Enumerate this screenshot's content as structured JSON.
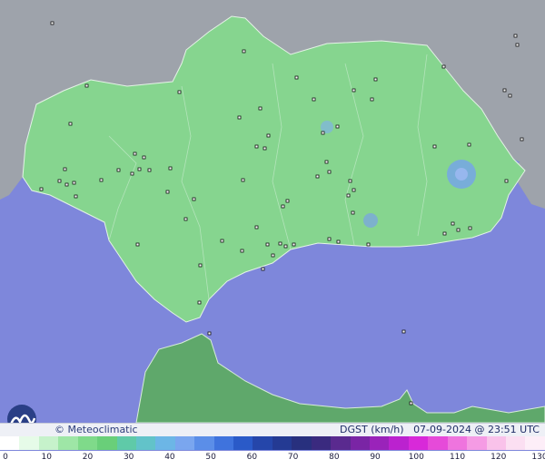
{
  "map": {
    "brand": "© Meteoclimatic",
    "parameter": "DGST (km/h)",
    "datetime": "07-09-2024 @ 23:51 UTC",
    "colors": {
      "sea": "#7e87db",
      "land_outside": "#9aa0aa",
      "region_land": "#86d58f",
      "region_land_dark": "#6fbf7c",
      "north_africa": "#5fa86b"
    },
    "logo_icon": "meteoclimatic-logo-icon"
  },
  "legend": {
    "ticks": [
      "0",
      "10",
      "20",
      "30",
      "40",
      "50",
      "60",
      "70",
      "80",
      "90",
      "100",
      "110",
      "120",
      "130"
    ],
    "colors": [
      "#ffffff",
      "#e6fbe8",
      "#c6f2cb",
      "#9ee6a6",
      "#7fda8a",
      "#69cf79",
      "#5fcaa8",
      "#62c3c9",
      "#6cb6e6",
      "#7aa6ef",
      "#5b8ee8",
      "#3f73dd",
      "#2a5ac8",
      "#2546aa",
      "#243a93",
      "#28307e",
      "#3a2a7f",
      "#5a2a8f",
      "#7a25a5",
      "#9a23ba",
      "#bb22cf",
      "#d829d9",
      "#e64ad9",
      "#ef74de",
      "#f59be4",
      "#f9c2ea",
      "#fbdff2",
      "#fdeef8"
    ]
  }
}
